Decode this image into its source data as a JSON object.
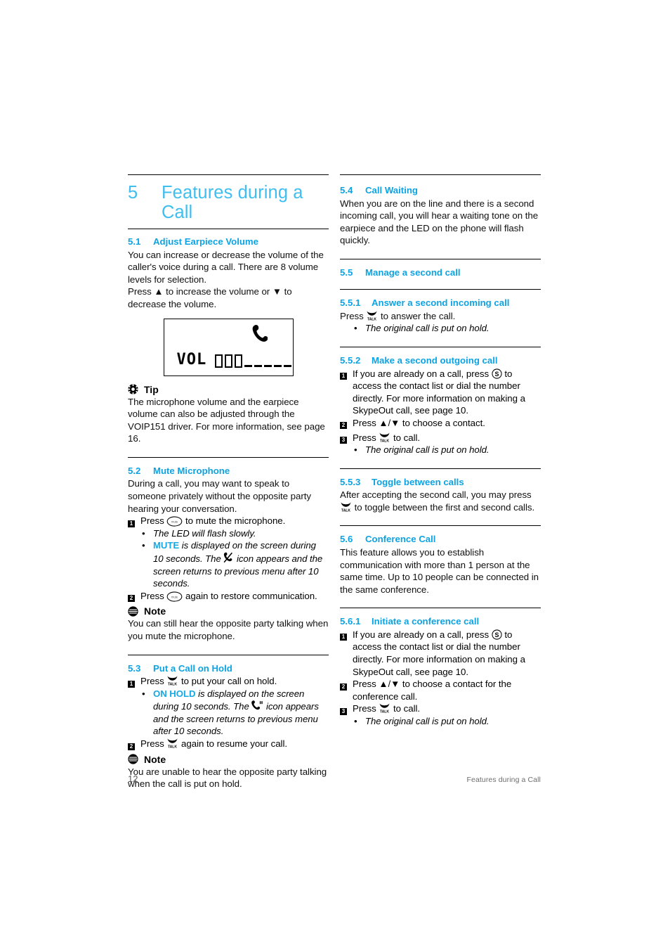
{
  "chapter": {
    "number": "5",
    "title": "Features during a Call"
  },
  "colors": {
    "chapter_blue": "#3FBEEF",
    "heading_blue": "#0DA3E2",
    "highlight_blue": "#17A9E5",
    "body_black": "#101010",
    "footer_gray": "#6E6E70"
  },
  "left_column": {
    "s51": {
      "number": "5.1",
      "title": "Adjust Earpiece Volume",
      "p1": "You can increase or decrease the volume of the caller's voice during a call. There are 8 volume levels for selection.",
      "p2": "Press ▲ to increase the volume or ▼ to decrease the volume.",
      "figure": {
        "label": "VOL",
        "bars_on": 3,
        "bars_off": 5,
        "icon": "handset-icon"
      },
      "tip": {
        "icon": "tip-icon",
        "label": "Tip",
        "text": "The microphone volume and the earpiece volume can also be adjusted through the VOIP151 driver. For more information, see page 16."
      }
    },
    "s52": {
      "number": "5.2",
      "title": "Mute Microphone",
      "p1": "During a call, you may want to speak to someone privately without the opposite party hearing your conversation.",
      "steps": [
        {
          "marker": "1",
          "pre": "Press ",
          "icon": "mute-button-icon",
          "post": " to mute the microphone.",
          "subs": [
            {
              "plain": "The LED will flash slowly."
            },
            {
              "highlight": "MUTE",
              "part1": " is displayed on the screen during 10 seconds. The ",
              "icon": "mute-handset-icon",
              "part2": " icon appears and the screen returns to previous menu after 10 seconds."
            }
          ]
        },
        {
          "marker": "2",
          "pre": "Press ",
          "icon": "mute-button-icon",
          "post": " again to restore communication."
        }
      ],
      "note": {
        "icon": "note-icon",
        "label": "Note",
        "text": "You can still hear the opposite party talking when you mute the microphone."
      }
    },
    "s53": {
      "number": "5.3",
      "title": "Put a Call on Hold",
      "steps": [
        {
          "marker": "1",
          "pre": "Press ",
          "icon": "talk-button-icon",
          "post": " to put your call on hold.",
          "subs": [
            {
              "highlight": "ON HOLD",
              "part1": " is displayed on the screen during 10 seconds. The ",
              "icon": "hold-handset-icon",
              "part2": " icon appears and the screen returns to previous menu after 10 seconds."
            }
          ]
        },
        {
          "marker": "2",
          "pre": "Press ",
          "icon": "talk-button-icon",
          "post": " again to resume your call."
        }
      ],
      "note": {
        "icon": "note-icon",
        "label": "Note",
        "text": "You are unable to hear the opposite party talking when the call is put on hold."
      }
    }
  },
  "right_column": {
    "s54": {
      "number": "5.4",
      "title": "Call Waiting",
      "p1": "When you are on the line and there is a second incoming call, you will hear a waiting tone on the earpiece and the LED on the phone will flash quickly."
    },
    "s55": {
      "number": "5.5",
      "title": "Manage a second call"
    },
    "s551": {
      "number": "5.5.1",
      "title": "Answer a second incoming call",
      "pre": "Press ",
      "icon": "talk-button-icon",
      "post": " to answer the call.",
      "subs": [
        {
          "plain": "The original call is put on hold."
        }
      ]
    },
    "s552": {
      "number": "5.5.2",
      "title": "Make a second outgoing call",
      "steps": [
        {
          "marker": "1",
          "pre": "If you are already on a call, press ",
          "icon": "skype-button-icon",
          "post": " to access the contact list or dial the number directly. For more information on making a SkypeOut call, see page 10."
        },
        {
          "marker": "2",
          "pre": "Press ▲/▼ to choose a contact.",
          "icon": "",
          "post": ""
        },
        {
          "marker": "3",
          "pre": "Press ",
          "icon": "talk-button-icon",
          "post": " to call.",
          "subs": [
            {
              "plain": "The original call is put on hold."
            }
          ]
        }
      ]
    },
    "s553": {
      "number": "5.5.3",
      "title": "Toggle between calls",
      "pre": "After accepting the second call, you may press ",
      "icon": "talk-button-icon",
      "post": " to toggle between the first and second calls."
    },
    "s56": {
      "number": "5.6",
      "title": "Conference Call",
      "p1": "This feature allows you to establish communication with more than 1 person at the same time. Up to 10 people can be connected in the same conference."
    },
    "s561": {
      "number": "5.6.1",
      "title": "Initiate a conference call",
      "steps": [
        {
          "marker": "1",
          "pre": "If you are already on a call, press ",
          "icon": "skype-button-icon",
          "post": " to access the contact list or dial the number directly. For more information on making a SkypeOut call, see page 10."
        },
        {
          "marker": "2",
          "pre": "Press ▲/▼ to choose a contact for the conference call.",
          "icon": "",
          "post": ""
        },
        {
          "marker": "3",
          "pre": "Press ",
          "icon": "talk-button-icon",
          "post": " to call.",
          "subs": [
            {
              "plain": "The original call is put on hold."
            }
          ]
        }
      ]
    }
  },
  "footer": {
    "page_number": "12",
    "running_title": "Features during a Call"
  }
}
